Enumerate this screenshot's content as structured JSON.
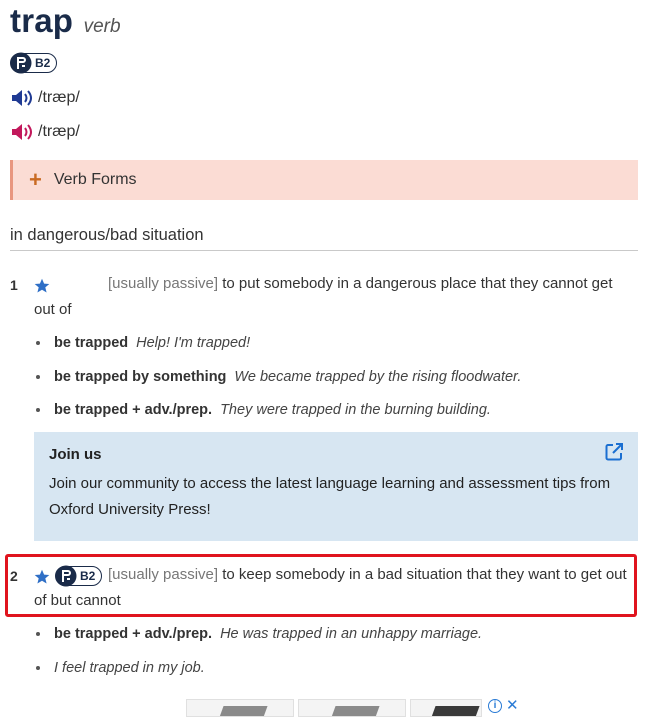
{
  "entry": {
    "headword": "trap",
    "pos": "verb",
    "cefr_level": "B2",
    "pron_uk": "/træp/",
    "pron_us": "/træp/",
    "verb_forms_label": "Verb Forms",
    "shortcut": "in dangerous/bad situation"
  },
  "senses": [
    {
      "num": "1",
      "grammar": "[usually passive]",
      "definition": "to put somebody in a dangerous place that they cannot get out of",
      "examples": [
        {
          "cf": "be trapped",
          "text": "Help! I'm trapped!"
        },
        {
          "cf": "be trapped by something",
          "text": "We became trapped by the rising floodwater."
        },
        {
          "cf": "be trapped + adv./prep.",
          "text": "They were trapped in the burning building."
        }
      ]
    },
    {
      "num": "2",
      "cefr_level": "B2",
      "grammar": "[usually passive]",
      "definition": "to keep somebody in a bad situation that they want to get out of but cannot",
      "examples": [
        {
          "cf": "be trapped + adv./prep.",
          "text": "He was trapped in an unhappy marriage."
        },
        {
          "cf": "",
          "text": "I feel trapped in my job."
        }
      ]
    }
  ],
  "join_box": {
    "title": "Join us",
    "text": "Join our community to access the latest language learning and assessment tips from Oxford University Press!"
  },
  "colors": {
    "headword": "#1a2b49",
    "uk_speaker": "#1f3a93",
    "us_speaker": "#c2185b",
    "verb_forms_bg": "#fbdcd4",
    "join_bg": "#d7e6f2",
    "highlight": "#e0141e",
    "star": "#2f6fc6"
  },
  "icons": {
    "uk_audio": "speaker-icon",
    "us_audio": "speaker-icon",
    "favorite": "star-icon",
    "external": "external-link-icon",
    "oxford": "oxford-key-icon"
  }
}
